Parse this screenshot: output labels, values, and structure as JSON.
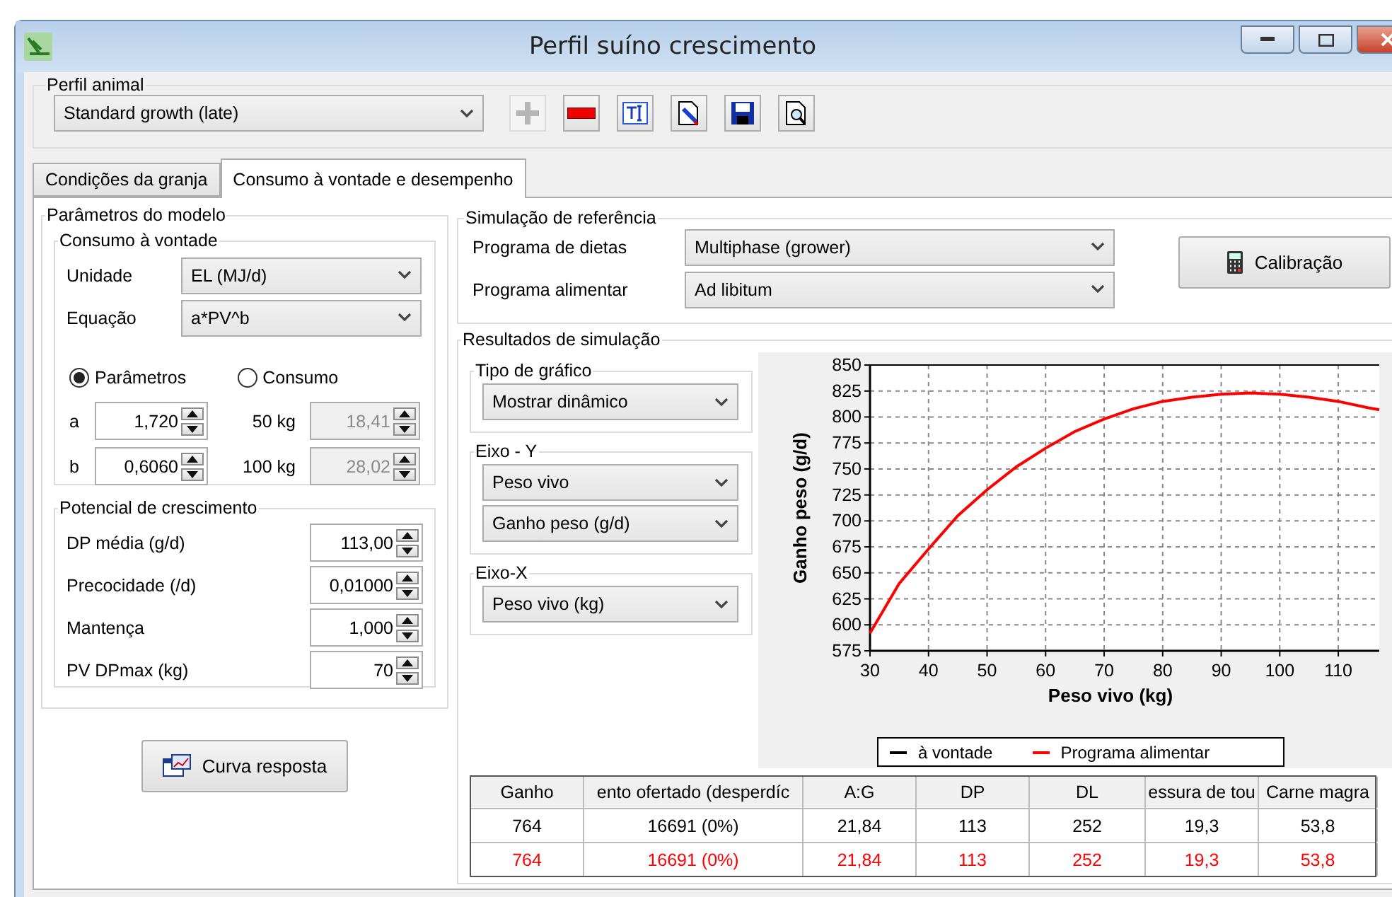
{
  "window": {
    "title": "Perfil suíno crescimento"
  },
  "profile": {
    "label": "Perfil animal",
    "value": "Standard growth (late)",
    "toolbar": [
      {
        "kind": "add",
        "disabled": true
      },
      {
        "kind": "remove",
        "disabled": false
      },
      {
        "kind": "rename",
        "disabled": false
      },
      {
        "kind": "edit",
        "disabled": false
      },
      {
        "kind": "save",
        "disabled": false
      },
      {
        "kind": "preview",
        "disabled": false
      }
    ]
  },
  "tabs": [
    {
      "label": "Condições da granja",
      "selected": false
    },
    {
      "label": "Consumo à vontade e desempenho",
      "selected": true
    }
  ],
  "model_params": {
    "title": "Parâmetros do modelo",
    "intake": {
      "title": "Consumo à vontade",
      "selects": [
        {
          "label": "Unidade",
          "value": "EL (MJ/d)"
        },
        {
          "label": "Equação",
          "value": "a*PV^b"
        }
      ],
      "modes": [
        {
          "label": "Parâmetros",
          "selected": true
        },
        {
          "label": "Consumo",
          "selected": false
        }
      ],
      "rows": [
        {
          "param": {
            "label": "a",
            "value": "1,720",
            "disabled": false
          },
          "intake": {
            "label": "50 kg",
            "value": "18,41",
            "disabled": true
          }
        },
        {
          "param": {
            "label": "b",
            "value": "0,6060",
            "disabled": false
          },
          "intake": {
            "label": "100 kg",
            "value": "28,02",
            "disabled": true
          }
        }
      ]
    },
    "growth": {
      "title": "Potencial de crescimento",
      "fields": [
        {
          "label": "DP média (g/d)",
          "value": "113,00"
        },
        {
          "label": "Precocidade (/d)",
          "value": "0,01000"
        },
        {
          "label": "Mantença",
          "value": "1,000"
        },
        {
          "label": "PV DPmax (kg)",
          "value": "70"
        }
      ]
    }
  },
  "response_button": "Curva resposta",
  "reference": {
    "title": "Simulação de referência",
    "selects": [
      {
        "label": "Programa de dietas",
        "value": "Multiphase (grower)"
      },
      {
        "label": "Programa alimentar",
        "value": "Ad libitum"
      }
    ],
    "button": "Calibração"
  },
  "results": {
    "title": "Resultados de simulação",
    "chart_type": {
      "title": "Tipo de gráfico",
      "values": [
        "Mostrar dinâmico"
      ]
    },
    "y_axis": {
      "title": "Eixo - Y",
      "values": [
        "Peso vivo",
        "Ganho peso (g/d)"
      ]
    },
    "x_axis": {
      "title": "Eixo-X",
      "values": [
        "Peso vivo (kg)"
      ]
    },
    "chart_data": {
      "type": "line",
      "xlabel": "Peso vivo (kg)",
      "ylabel": "Ganho peso (g/d)",
      "x": [
        30,
        35,
        40,
        45,
        50,
        55,
        60,
        65,
        70,
        75,
        80,
        85,
        90,
        95,
        100,
        105,
        110,
        115,
        117
      ],
      "series": [
        {
          "name": "à vontade",
          "color": "#000000",
          "values": [
            null,
            null,
            null,
            null,
            null,
            null,
            null,
            null,
            null,
            null,
            null,
            null,
            null,
            null,
            null,
            null,
            null,
            null,
            null
          ]
        },
        {
          "name": "Programa alimentar",
          "color": "#ff0000",
          "values": [
            592,
            640,
            673,
            705,
            730,
            752,
            770,
            786,
            798,
            808,
            815,
            819,
            822,
            823,
            822,
            819,
            815,
            809,
            807
          ]
        }
      ],
      "grid": true,
      "xlim": [
        30,
        117
      ],
      "ylim": [
        575,
        850
      ],
      "xticks": [
        30,
        40,
        50,
        60,
        70,
        80,
        90,
        100,
        110
      ],
      "yticks": [
        575,
        600,
        625,
        650,
        675,
        700,
        725,
        750,
        775,
        800,
        825,
        850
      ]
    },
    "table": {
      "columns": [
        "Ganho",
        "ento ofertado (desperdíc",
        "A:G",
        "DP",
        "DL",
        "essura de tou",
        "Carne magra"
      ],
      "rows": [
        {
          "color": "#000000",
          "cells": [
            "764",
            "16691 (0%)",
            "21,84",
            "113",
            "252",
            "19,3",
            "53,8"
          ]
        },
        {
          "color": "#ff0000",
          "cells": [
            "764",
            "16691 (0%)",
            "21,84",
            "113",
            "252",
            "19,3",
            "53,8"
          ]
        }
      ]
    }
  }
}
